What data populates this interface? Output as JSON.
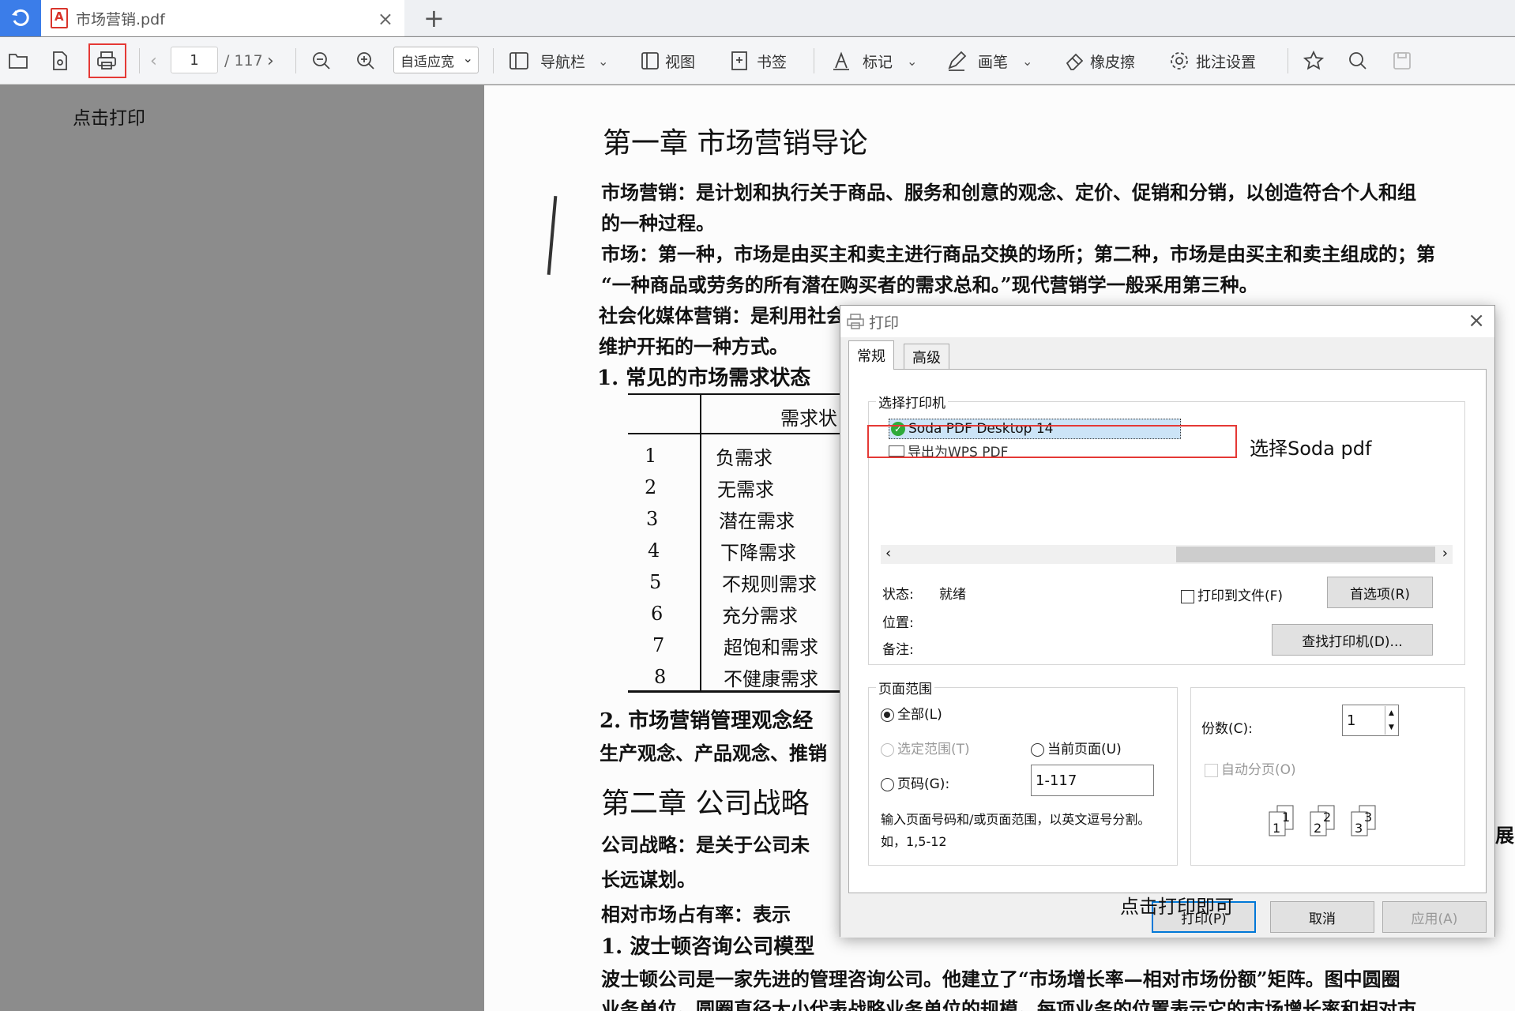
{
  "tab": {
    "title": "市场营销.pdf",
    "close": "×",
    "new": "+"
  },
  "toolbar": {
    "page_current": "1",
    "page_total": "/ 117",
    "zoom": "自适应宽",
    "nav": "导航栏",
    "view": "视图",
    "bookmark": "书签",
    "mark": "标记",
    "pen": "画笔",
    "eraser": "橡皮擦",
    "annot": "批注设置"
  },
  "left_note": "点击打印",
  "document": {
    "lines": [
      "第一章  市场营销导论",
      "市场营销：是计划和执行关于商品、服务和创意的观念、定价、促销和分销，以创造符合个人和组",
      "的一种过程。",
      "市场：第一种，市场是由买主和卖主进行商品交换的场所；第二种，市场是由买主和卖主组成的；第",
      "“一种商品或劳务的所有潜在购买者的需求总和。”现代营销学一般采用第三种。",
      "社会化媒体营销：是利用社会化网络、在线社区、博客、百科或者其他互联网协作平台媒体进行营",
      "维护开拓的一种方式。",
      "1. 常见的市场需求状态",
      "2. 市场营销管理观念经",
      "生产观念、产品观念、推销",
      "第二章  公司战略",
      "公司战略：是关于公司未",
      "长远谋划。",
      "相对市场占有率：表示",
      "1. 波士顿咨询公司模型",
      "波士顿公司是一家先进的管理咨询公司。他建立了“市场增长率—相对市场份额”矩阵。图中圆圈",
      "业务单位。圆圈直径大小代表战略业务单位的规模。每项业务的位置表示它的市场增长率和相对市"
    ],
    "table_header": "需求状",
    "table_nums": [
      "1",
      "2",
      "3",
      "4",
      "5",
      "6",
      "7",
      "8"
    ],
    "table_items": [
      "负需求",
      "无需求",
      "潜在需求",
      "下降需求",
      "不规则需求",
      "充分需求",
      "超饱和需求",
      "不健康需求"
    ],
    "right_edge": "展"
  },
  "dialog": {
    "title": "打印",
    "tabs": [
      "常规",
      "高级"
    ],
    "printer_group": "选择打印机",
    "printers": [
      "Soda PDF Desktop 14",
      "导出为WPS PDF"
    ],
    "status_label": "状态:",
    "status_value": "就绪",
    "location_label": "位置:",
    "comment_label": "备注:",
    "print_to_file": "打印到文件(F)",
    "preferences": "首选项(R)",
    "find_printer": "查找打印机(D)...",
    "range_group": "页面范围",
    "range_all": "全部(L)",
    "range_selection": "选定范围(T)",
    "range_current": "当前页面(U)",
    "range_pages": "页码(G):",
    "range_value": "1-117",
    "range_hint": "输入页面号码和/或页面范围，以英文逗号分割。如，1,5-12",
    "copies_label": "份数(C):",
    "copies_value": "1",
    "collate": "自动分页(O)",
    "print_btn": "打印(P)",
    "cancel_btn": "取消",
    "apply_btn": "应用(A)"
  },
  "notes": {
    "select": "选择Soda pdf",
    "print": "点击打印即可"
  }
}
